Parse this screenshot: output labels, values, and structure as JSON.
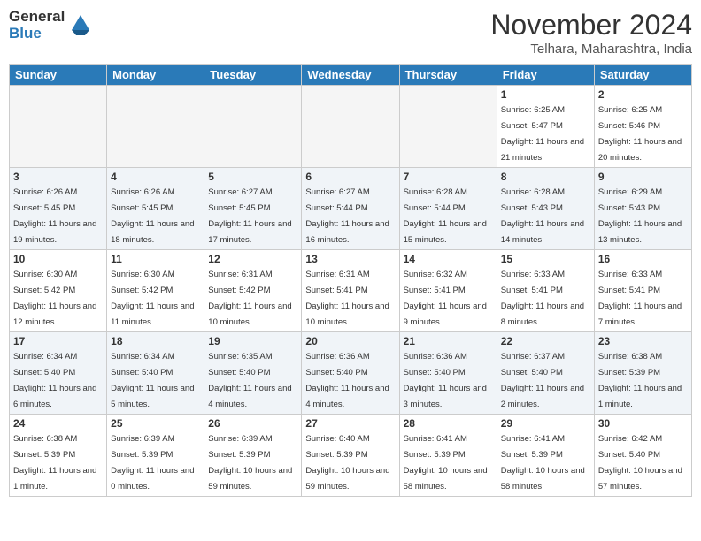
{
  "header": {
    "logo_general": "General",
    "logo_blue": "Blue",
    "month_title": "November 2024",
    "location": "Telhara, Maharashtra, India"
  },
  "days_of_week": [
    "Sunday",
    "Monday",
    "Tuesday",
    "Wednesday",
    "Thursday",
    "Friday",
    "Saturday"
  ],
  "weeks": [
    [
      {
        "day": "",
        "info": ""
      },
      {
        "day": "",
        "info": ""
      },
      {
        "day": "",
        "info": ""
      },
      {
        "day": "",
        "info": ""
      },
      {
        "day": "",
        "info": ""
      },
      {
        "day": "1",
        "info": "Sunrise: 6:25 AM\nSunset: 5:47 PM\nDaylight: 11 hours and 21 minutes."
      },
      {
        "day": "2",
        "info": "Sunrise: 6:25 AM\nSunset: 5:46 PM\nDaylight: 11 hours and 20 minutes."
      }
    ],
    [
      {
        "day": "3",
        "info": "Sunrise: 6:26 AM\nSunset: 5:45 PM\nDaylight: 11 hours and 19 minutes."
      },
      {
        "day": "4",
        "info": "Sunrise: 6:26 AM\nSunset: 5:45 PM\nDaylight: 11 hours and 18 minutes."
      },
      {
        "day": "5",
        "info": "Sunrise: 6:27 AM\nSunset: 5:45 PM\nDaylight: 11 hours and 17 minutes."
      },
      {
        "day": "6",
        "info": "Sunrise: 6:27 AM\nSunset: 5:44 PM\nDaylight: 11 hours and 16 minutes."
      },
      {
        "day": "7",
        "info": "Sunrise: 6:28 AM\nSunset: 5:44 PM\nDaylight: 11 hours and 15 minutes."
      },
      {
        "day": "8",
        "info": "Sunrise: 6:28 AM\nSunset: 5:43 PM\nDaylight: 11 hours and 14 minutes."
      },
      {
        "day": "9",
        "info": "Sunrise: 6:29 AM\nSunset: 5:43 PM\nDaylight: 11 hours and 13 minutes."
      }
    ],
    [
      {
        "day": "10",
        "info": "Sunrise: 6:30 AM\nSunset: 5:42 PM\nDaylight: 11 hours and 12 minutes."
      },
      {
        "day": "11",
        "info": "Sunrise: 6:30 AM\nSunset: 5:42 PM\nDaylight: 11 hours and 11 minutes."
      },
      {
        "day": "12",
        "info": "Sunrise: 6:31 AM\nSunset: 5:42 PM\nDaylight: 11 hours and 10 minutes."
      },
      {
        "day": "13",
        "info": "Sunrise: 6:31 AM\nSunset: 5:41 PM\nDaylight: 11 hours and 10 minutes."
      },
      {
        "day": "14",
        "info": "Sunrise: 6:32 AM\nSunset: 5:41 PM\nDaylight: 11 hours and 9 minutes."
      },
      {
        "day": "15",
        "info": "Sunrise: 6:33 AM\nSunset: 5:41 PM\nDaylight: 11 hours and 8 minutes."
      },
      {
        "day": "16",
        "info": "Sunrise: 6:33 AM\nSunset: 5:41 PM\nDaylight: 11 hours and 7 minutes."
      }
    ],
    [
      {
        "day": "17",
        "info": "Sunrise: 6:34 AM\nSunset: 5:40 PM\nDaylight: 11 hours and 6 minutes."
      },
      {
        "day": "18",
        "info": "Sunrise: 6:34 AM\nSunset: 5:40 PM\nDaylight: 11 hours and 5 minutes."
      },
      {
        "day": "19",
        "info": "Sunrise: 6:35 AM\nSunset: 5:40 PM\nDaylight: 11 hours and 4 minutes."
      },
      {
        "day": "20",
        "info": "Sunrise: 6:36 AM\nSunset: 5:40 PM\nDaylight: 11 hours and 4 minutes."
      },
      {
        "day": "21",
        "info": "Sunrise: 6:36 AM\nSunset: 5:40 PM\nDaylight: 11 hours and 3 minutes."
      },
      {
        "day": "22",
        "info": "Sunrise: 6:37 AM\nSunset: 5:40 PM\nDaylight: 11 hours and 2 minutes."
      },
      {
        "day": "23",
        "info": "Sunrise: 6:38 AM\nSunset: 5:39 PM\nDaylight: 11 hours and 1 minute."
      }
    ],
    [
      {
        "day": "24",
        "info": "Sunrise: 6:38 AM\nSunset: 5:39 PM\nDaylight: 11 hours and 1 minute."
      },
      {
        "day": "25",
        "info": "Sunrise: 6:39 AM\nSunset: 5:39 PM\nDaylight: 11 hours and 0 minutes."
      },
      {
        "day": "26",
        "info": "Sunrise: 6:39 AM\nSunset: 5:39 PM\nDaylight: 10 hours and 59 minutes."
      },
      {
        "day": "27",
        "info": "Sunrise: 6:40 AM\nSunset: 5:39 PM\nDaylight: 10 hours and 59 minutes."
      },
      {
        "day": "28",
        "info": "Sunrise: 6:41 AM\nSunset: 5:39 PM\nDaylight: 10 hours and 58 minutes."
      },
      {
        "day": "29",
        "info": "Sunrise: 6:41 AM\nSunset: 5:39 PM\nDaylight: 10 hours and 58 minutes."
      },
      {
        "day": "30",
        "info": "Sunrise: 6:42 AM\nSunset: 5:40 PM\nDaylight: 10 hours and 57 minutes."
      }
    ]
  ]
}
